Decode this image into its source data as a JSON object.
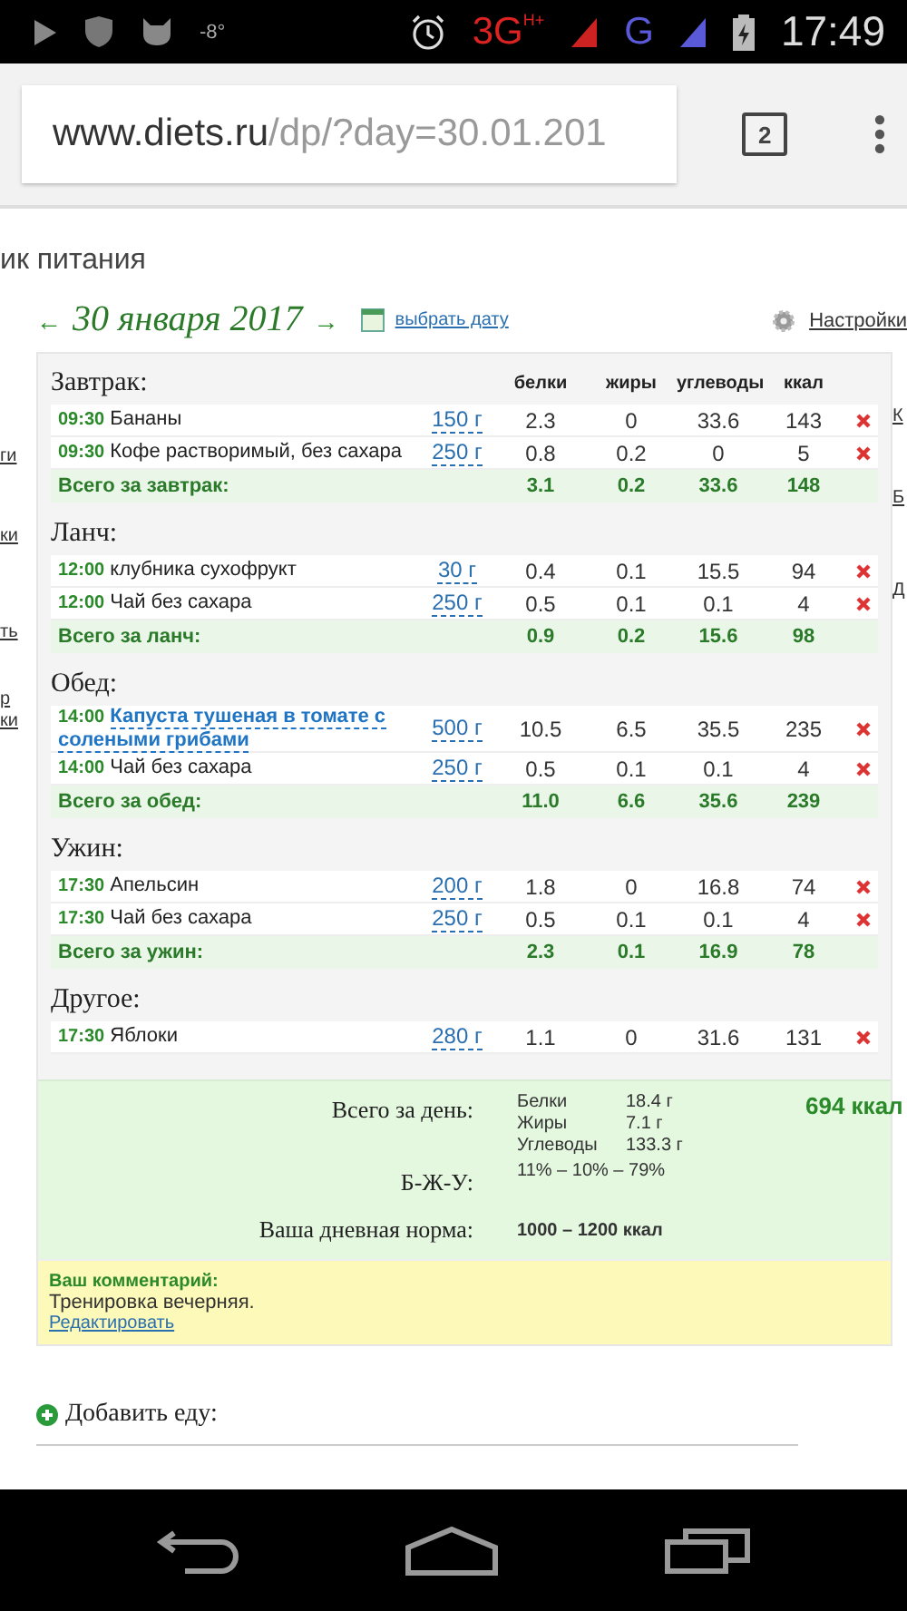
{
  "status_bar": {
    "temperature": "-8°",
    "network_1": "3G",
    "network_1_sup": "H+",
    "network_2": "G",
    "time": "17:49"
  },
  "browser": {
    "url_host": "www.diets.ru",
    "url_path": "/dp/?day=30.01.201",
    "tab_count": "2"
  },
  "page": {
    "title": "ик питания",
    "prev": "←",
    "date": "30 января 2017",
    "next": "→",
    "pick_date": "выбрать дату",
    "settings": "Настройки"
  },
  "left_fragments": [
    "ги",
    "ки",
    "ть",
    "р",
    "ки"
  ],
  "right_fragments": [
    "К",
    "Б",
    "Д"
  ],
  "columns": [
    "белки",
    "жиры",
    "углеводы",
    "ккал"
  ],
  "meals": [
    {
      "title": "Завтрак:",
      "items": [
        {
          "time": "09:30",
          "name": "Бананы",
          "linked": false,
          "amount": "150 г",
          "values": [
            "2.3",
            "0",
            "33.6",
            "143"
          ]
        },
        {
          "time": "09:30",
          "name": "Кофе растворимый, без сахара",
          "linked": false,
          "amount": "250 г",
          "values": [
            "0.8",
            "0.2",
            "0",
            "5"
          ]
        }
      ],
      "total": {
        "label": "Всего за завтрак:",
        "values": [
          "3.1",
          "0.2",
          "33.6",
          "148"
        ]
      }
    },
    {
      "title": "Ланч:",
      "items": [
        {
          "time": "12:00",
          "name": "клубника сухофрукт",
          "linked": false,
          "amount": "30 г",
          "values": [
            "0.4",
            "0.1",
            "15.5",
            "94"
          ]
        },
        {
          "time": "12:00",
          "name": "Чай без сахара",
          "linked": false,
          "amount": "250 г",
          "values": [
            "0.5",
            "0.1",
            "0.1",
            "4"
          ]
        }
      ],
      "total": {
        "label": "Всего за ланч:",
        "values": [
          "0.9",
          "0.2",
          "15.6",
          "98"
        ]
      }
    },
    {
      "title": "Обед:",
      "items": [
        {
          "time": "14:00",
          "name": "Капуста тушеная в томате с солеными грибами",
          "linked": true,
          "amount": "500 г",
          "values": [
            "10.5",
            "6.5",
            "35.5",
            "235"
          ]
        },
        {
          "time": "14:00",
          "name": "Чай без сахара",
          "linked": false,
          "amount": "250 г",
          "values": [
            "0.5",
            "0.1",
            "0.1",
            "4"
          ]
        }
      ],
      "total": {
        "label": "Всего за обед:",
        "values": [
          "11.0",
          "6.6",
          "35.6",
          "239"
        ]
      }
    },
    {
      "title": "Ужин:",
      "items": [
        {
          "time": "17:30",
          "name": "Апельсин",
          "linked": false,
          "amount": "200 г",
          "values": [
            "1.8",
            "0",
            "16.8",
            "74"
          ]
        },
        {
          "time": "17:30",
          "name": "Чай без сахара",
          "linked": false,
          "amount": "250 г",
          "values": [
            "0.5",
            "0.1",
            "0.1",
            "4"
          ]
        }
      ],
      "total": {
        "label": "Всего за ужин:",
        "values": [
          "2.3",
          "0.1",
          "16.9",
          "78"
        ]
      }
    },
    {
      "title": "Другое:",
      "items": [
        {
          "time": "17:30",
          "name": "Яблоки",
          "linked": false,
          "amount": "280 г",
          "values": [
            "1.1",
            "0",
            "31.6",
            "131"
          ]
        }
      ]
    }
  ],
  "summary": {
    "day_label": "Всего за день:",
    "nutrients": [
      {
        "name": "Белки",
        "value": "18.4 г"
      },
      {
        "name": "Жиры",
        "value": "7.1 г"
      },
      {
        "name": "Углеводы",
        "value": "133.3 г"
      }
    ],
    "kcal": "694 ккал",
    "ratio_label": "Б-Ж-У:",
    "ratio": "11% – 10% – 79%",
    "norm_label": "Ваша дневная норма:",
    "norm": "1000 – 1200 ккал"
  },
  "comment": {
    "label": "Ваш комментарий:",
    "text": "Тренировка вечерняя.",
    "edit": "Редактировать"
  },
  "add_food": "Добавить еду:"
}
